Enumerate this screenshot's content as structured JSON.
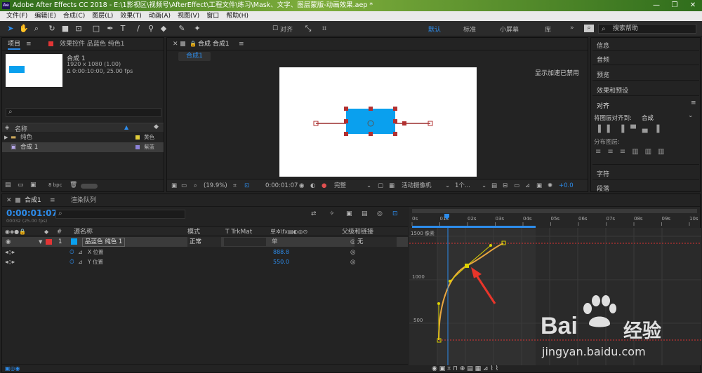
{
  "app": {
    "title": "Adobe After Effects CC 2018 - E:\\1影视区\\视频号\\AfterEffect\\工程文件\\练习\\Mask、文字、图层蒙版-动画效果.aep *",
    "logo": "Ae",
    "window_buttons": [
      "—",
      "❐",
      "✕"
    ]
  },
  "menu": [
    "文件(F)",
    "编辑(E)",
    "合成(C)",
    "图层(L)",
    "效果(T)",
    "动画(A)",
    "视图(V)",
    "窗口",
    "帮助(H)"
  ],
  "toolbar": {
    "align_label": "对齐",
    "workspaces": [
      "默认",
      "标准",
      "小屏幕",
      "库"
    ],
    "active_workspace": "默认",
    "more": "»",
    "help_search_placeholder": "搜索帮助"
  },
  "project_panel": {
    "tab_project": "项目",
    "tab_effects": "效果控件 品蓝色 纯色1",
    "comp_name": "合成 1",
    "comp_size": "1920 x 1080 (1.00)",
    "comp_duration": "Δ 0:00:10:00, 25.00 fps",
    "col_name": "名称",
    "items": [
      {
        "name": "纯色",
        "color_label": "黄色",
        "type": "folder"
      },
      {
        "name": "合成 1",
        "color_label": "紫蓝",
        "type": "comp"
      }
    ],
    "bpc": "8 bpc"
  },
  "viewer": {
    "tab": "合成 合成1",
    "sub_tab": "合成1",
    "gpu_note": "显示加速已禁用",
    "zoom": "(19.9%)",
    "timecode": "0:00:01:07",
    "quality": "完整",
    "camera": "活动摄像机",
    "views": "1个...",
    "exposure": "+0.0"
  },
  "right_panel": {
    "items": [
      "信息",
      "音频",
      "预览",
      "效果和预设"
    ],
    "align_title": "对齐",
    "align_to_label": "将图层对齐到:",
    "align_to_value": "合成",
    "distribute_label": "分布图层:",
    "bottom_items": [
      "字符",
      "段落"
    ]
  },
  "timeline": {
    "tab_comp": "合成1",
    "tab_render": "渲染队列",
    "timecode": "0:00:01:07",
    "frames": "00032 (25.00 fps)",
    "col_source": "源名称",
    "col_mode": "模式",
    "col_trkmat": "T  TrkMat",
    "col_parent": "父级和链接",
    "layer_number": "1",
    "layer_name": "品蓝色 纯色 1",
    "layer_mode": "正常",
    "layer_parent": "无",
    "props": [
      {
        "name": "X 位置",
        "value": "888.8"
      },
      {
        "name": "Y 位置",
        "value": "550.0"
      }
    ],
    "ruler": [
      "0s",
      "01s",
      "02s",
      "03s",
      "04s",
      "05s",
      "06s",
      "07s",
      "08s",
      "09s",
      "10s"
    ],
    "graph_labels": [
      "1500 像素",
      "1000",
      "500"
    ]
  },
  "watermark": {
    "brand": "Bai",
    "brand2": "经验",
    "url": "jingyan.baidu.com"
  },
  "colors": {
    "accent": "#2d8ceb",
    "layer_label": "#e23535",
    "solid_color": "#0aa0ee",
    "curve": "#e8a640"
  }
}
